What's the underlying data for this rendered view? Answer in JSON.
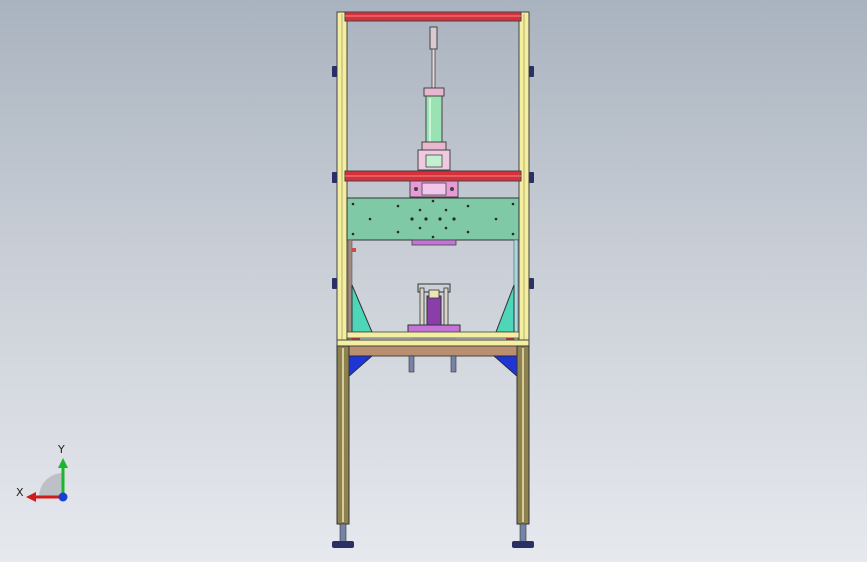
{
  "triad": {
    "x_label": "X",
    "y_label": "Y",
    "x_color": "#d21b1b",
    "y_color": "#1bb52f",
    "z_color": "#1b3fd2"
  },
  "colors": {
    "frame_yellow": "#f3eea0",
    "crossbar_red": "#d8303a",
    "plate_green": "#7fc9a6",
    "cylinder_green": "#9ae2b4",
    "pink_block": "#e79bd6",
    "purple_part": "#a03fb0",
    "blue_bracket": "#1f35d6",
    "cyan_gusset": "#4dd6b8",
    "leg_olive": "#8d8150"
  }
}
